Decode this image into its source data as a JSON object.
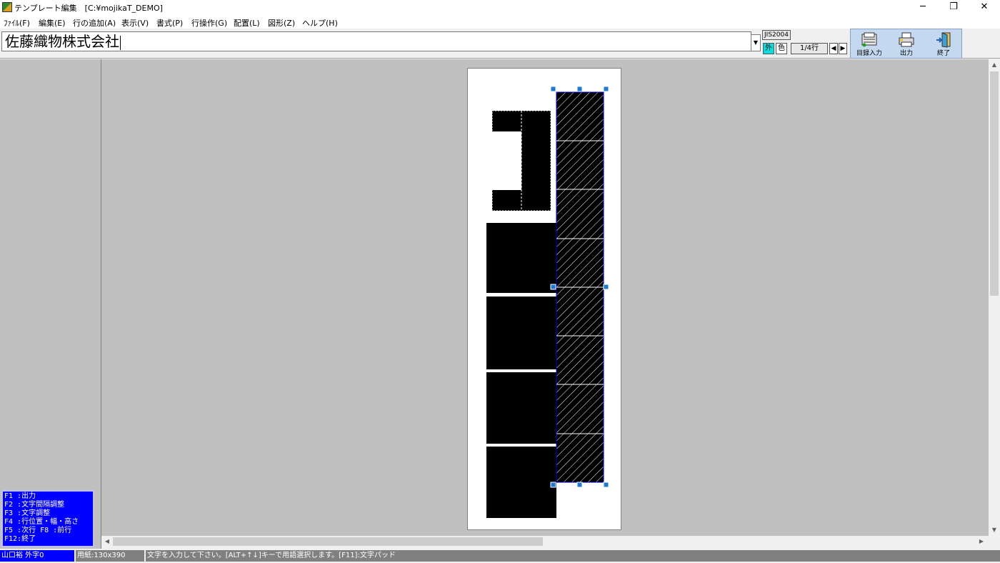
{
  "window": {
    "title": "テンプレート編集　[C:¥mojikaT_DEMO]",
    "minimize_glyph": "─",
    "restore_glyph": "❐",
    "close_glyph": "✕"
  },
  "menubar": {
    "items": [
      "ﾌｧｲﾙ(F)",
      "編集(E)",
      "行の追加(A)",
      "表示(V)",
      "書式(P)",
      "行操作(G)",
      "配置(L)",
      "図形(Z)",
      "ヘルプ(H)"
    ]
  },
  "input": {
    "value": "佐藤織物株式会社"
  },
  "controls": {
    "jis_label": "JIS2004",
    "gai_label": "外",
    "color_label": "色",
    "line_counter": "1/4行",
    "prev_glyph": "◀",
    "next_glyph": "▶",
    "dropdown_glyph": "▼"
  },
  "toolbar": {
    "buttons": [
      {
        "label": "目録入力",
        "icon": "register-icon"
      },
      {
        "label": "出力",
        "icon": "printer-icon"
      },
      {
        "label": "終了",
        "icon": "exit-door-icon"
      }
    ]
  },
  "help": {
    "lines": [
      "F1 :出力",
      "F2 :文字間隔調整",
      "F3 :文字調整",
      "F4 :行位置・幅・高さ",
      "F5 :次行  F8 :前行",
      "F12:終了"
    ]
  },
  "scroll": {
    "up_glyph": "▲",
    "down_glyph": "▼",
    "left_glyph": "◀",
    "right_glyph": "▶"
  },
  "status": {
    "user": "山口裕 外字0",
    "paper": "用紙:130x390",
    "message": "文字を入力して下さい。[ALT+↑↓]キーで用語選択します。[F11]:文字パッド"
  }
}
